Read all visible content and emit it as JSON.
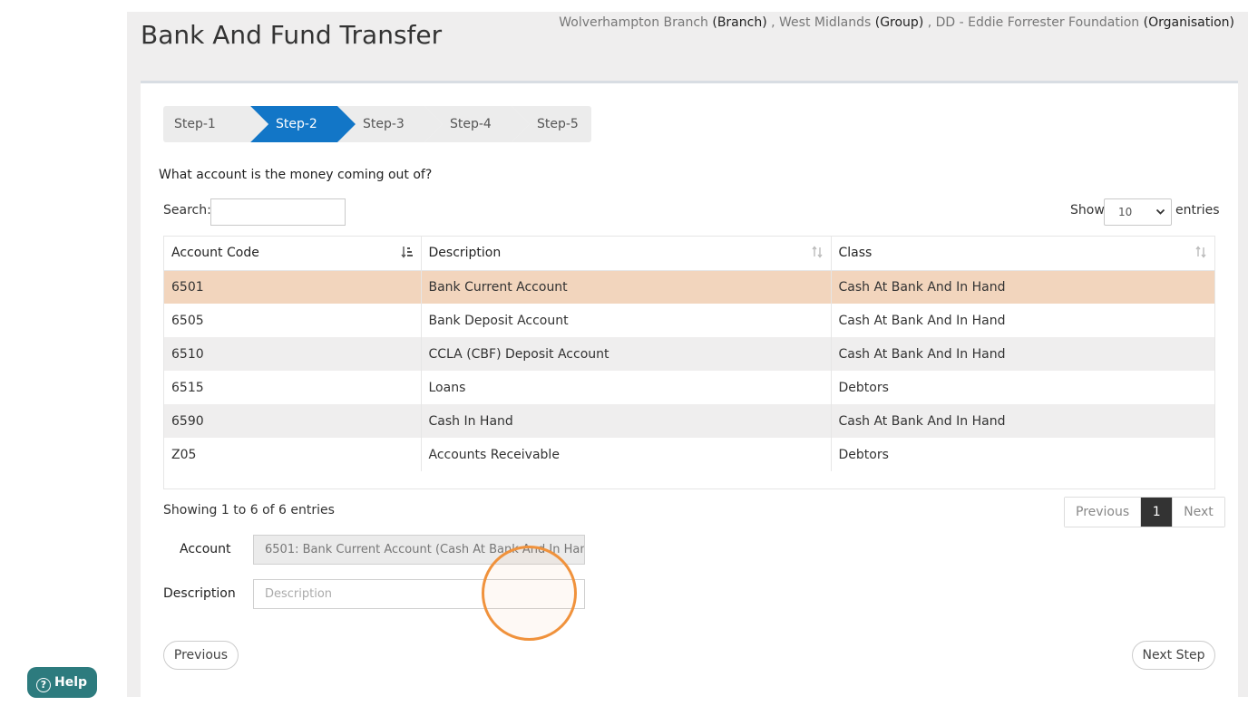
{
  "header": {
    "title": "Bank And Fund Transfer",
    "branch_name": "Wolverhampton Branch",
    "branch_tag": "(Branch)",
    "sep1": ",",
    "group_name": "West Midlands",
    "group_tag": "(Group)",
    "sep2": ",",
    "org_name": "DD - Eddie Forrester Foundation",
    "org_tag": "(Organisation)"
  },
  "steps": [
    {
      "label": "Step-1",
      "active": false
    },
    {
      "label": "Step-2",
      "active": true
    },
    {
      "label": "Step-3",
      "active": false
    },
    {
      "label": "Step-4",
      "active": false
    },
    {
      "label": "Step-5",
      "active": false
    }
  ],
  "question": "What account is the money coming out of?",
  "search": {
    "label": "Search:",
    "value": ""
  },
  "length": {
    "show_label": "Show",
    "selected": "10",
    "entries_label": "entries"
  },
  "table": {
    "columns": [
      "Account Code",
      "Description",
      "Class"
    ],
    "rows": [
      {
        "code": "6501",
        "description": "Bank Current Account",
        "class": "Cash At Bank And In Hand"
      },
      {
        "code": "6505",
        "description": "Bank Deposit Account",
        "class": "Cash At Bank And In Hand"
      },
      {
        "code": "6510",
        "description": "CCLA (CBF) Deposit Account",
        "class": "Cash At Bank And In Hand"
      },
      {
        "code": "6515",
        "description": "Loans",
        "class": "Debtors"
      },
      {
        "code": "6590",
        "description": "Cash In Hand",
        "class": "Cash At Bank And In Hand"
      },
      {
        "code": "Z05",
        "description": "Accounts Receivable",
        "class": "Debtors"
      }
    ]
  },
  "info": "Showing 1 to 6 of 6 entries",
  "pager": {
    "previous": "Previous",
    "current": "1",
    "next": "Next"
  },
  "form": {
    "account_label": "Account",
    "account_value": "6501: Bank Current Account (Cash At Bank And In Han",
    "description_label": "Description",
    "description_placeholder": "Description"
  },
  "buttons": {
    "previous": "Previous",
    "next_step": "Next Step"
  },
  "help": {
    "label": "Help",
    "q": "?"
  }
}
